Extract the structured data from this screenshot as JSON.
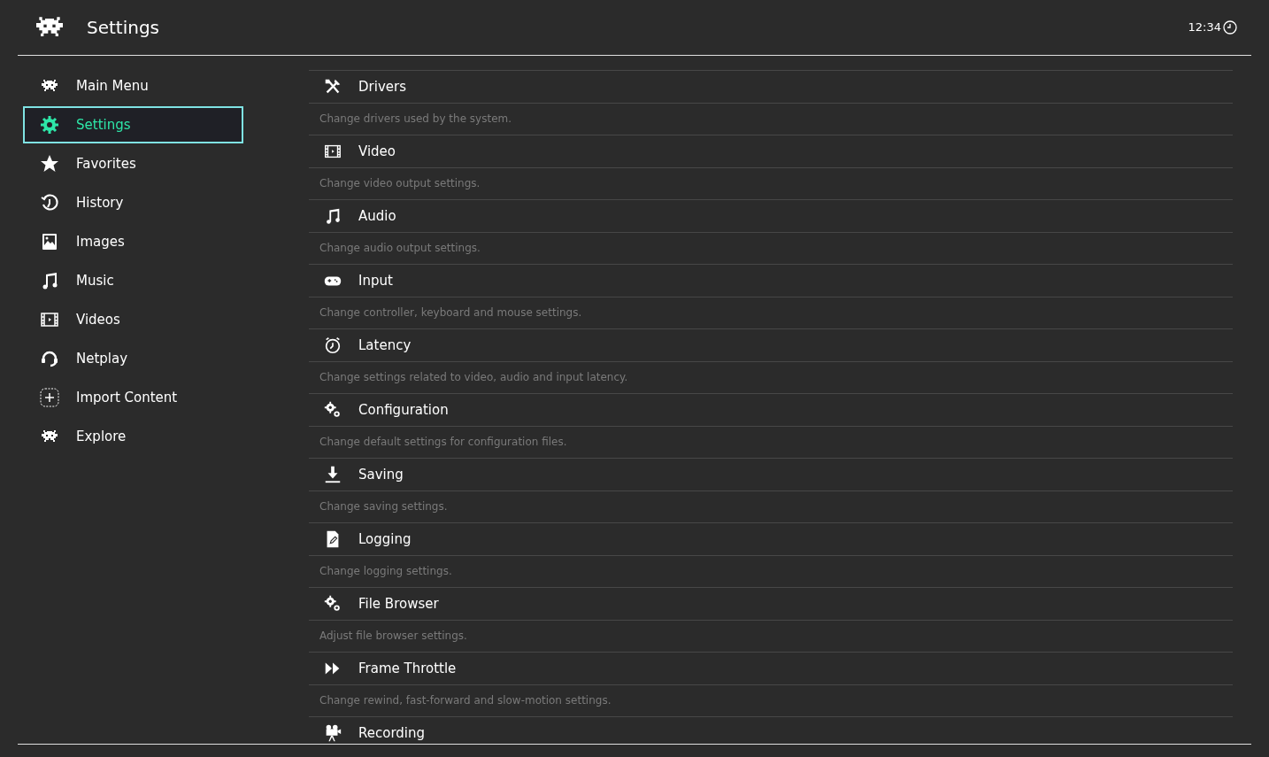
{
  "header": {
    "title": "Settings",
    "clock": "12:34"
  },
  "sidebar": {
    "items": [
      {
        "label": "Main Menu",
        "kind": "invader",
        "selected": false
      },
      {
        "label": "Settings",
        "kind": "gear",
        "selected": true
      },
      {
        "label": "Favorites",
        "kind": "star",
        "selected": false
      },
      {
        "label": "History",
        "kind": "history",
        "selected": false
      },
      {
        "label": "Images",
        "kind": "image",
        "selected": false
      },
      {
        "label": "Music",
        "kind": "music",
        "selected": false
      },
      {
        "label": "Videos",
        "kind": "film",
        "selected": false
      },
      {
        "label": "Netplay",
        "kind": "headset",
        "selected": false
      },
      {
        "label": "Import Content",
        "kind": "add",
        "selected": false
      },
      {
        "label": "Explore",
        "kind": "invader",
        "selected": false
      }
    ]
  },
  "settings": {
    "items": [
      {
        "label": "Drivers",
        "description": "Change drivers used by the system.",
        "kind": "tools"
      },
      {
        "label": "Video",
        "description": "Change video output settings.",
        "kind": "film"
      },
      {
        "label": "Audio",
        "description": "Change audio output settings.",
        "kind": "music"
      },
      {
        "label": "Input",
        "description": "Change controller, keyboard and mouse settings.",
        "kind": "gamepad"
      },
      {
        "label": "Latency",
        "description": "Change settings related to video, audio and input latency.",
        "kind": "timer"
      },
      {
        "label": "Configuration",
        "description": "Change default settings for configuration files.",
        "kind": "gears"
      },
      {
        "label": "Saving",
        "description": "Change saving settings.",
        "kind": "download"
      },
      {
        "label": "Logging",
        "description": "Change logging settings.",
        "kind": "file"
      },
      {
        "label": "File Browser",
        "description": "Adjust file browser settings.",
        "kind": "gears"
      },
      {
        "label": "Frame Throttle",
        "description": "Change rewind, fast-forward and slow-motion settings.",
        "kind": "forward"
      },
      {
        "label": "Recording",
        "kind": "camera"
      }
    ]
  }
}
